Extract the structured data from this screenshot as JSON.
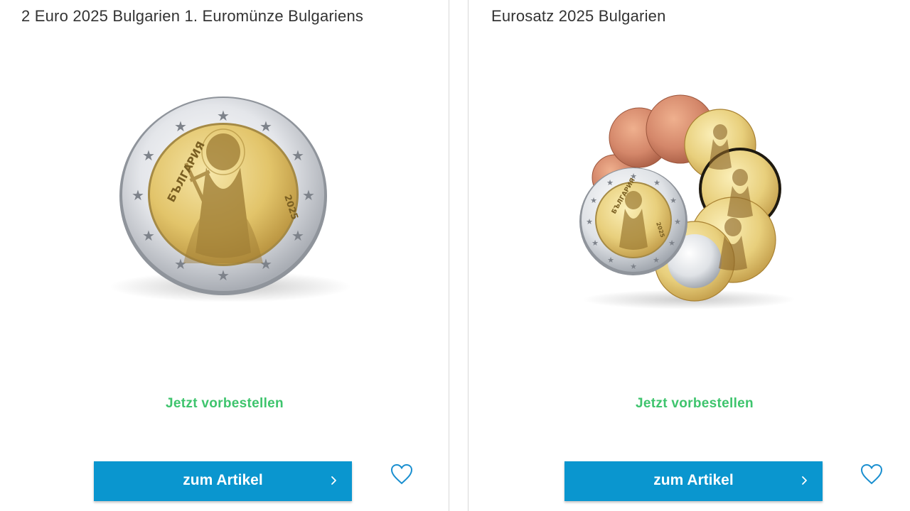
{
  "products": [
    {
      "title": "2 Euro 2025 Bulgarien 1. Euromünze Bulgariens",
      "status": "Jetzt vorbestellen",
      "button_label": "zum Artikel",
      "coin_inscription": "БЪЛГАРИЯ",
      "coin_year": "2025"
    },
    {
      "title": "Eurosatz 2025 Bulgarien",
      "status": "Jetzt vorbestellen",
      "button_label": "zum Artikel",
      "coin_inscription": "БЪЛГАРИЯ",
      "coin_year": "2025"
    }
  ],
  "icons": {
    "chevron": "chevron-right-icon",
    "wishlist": "heart-icon"
  },
  "colors": {
    "accent_button": "#0a96cf",
    "status_green": "#3ec46d",
    "heart": "#1a8fd0",
    "title_text": "#333333"
  }
}
